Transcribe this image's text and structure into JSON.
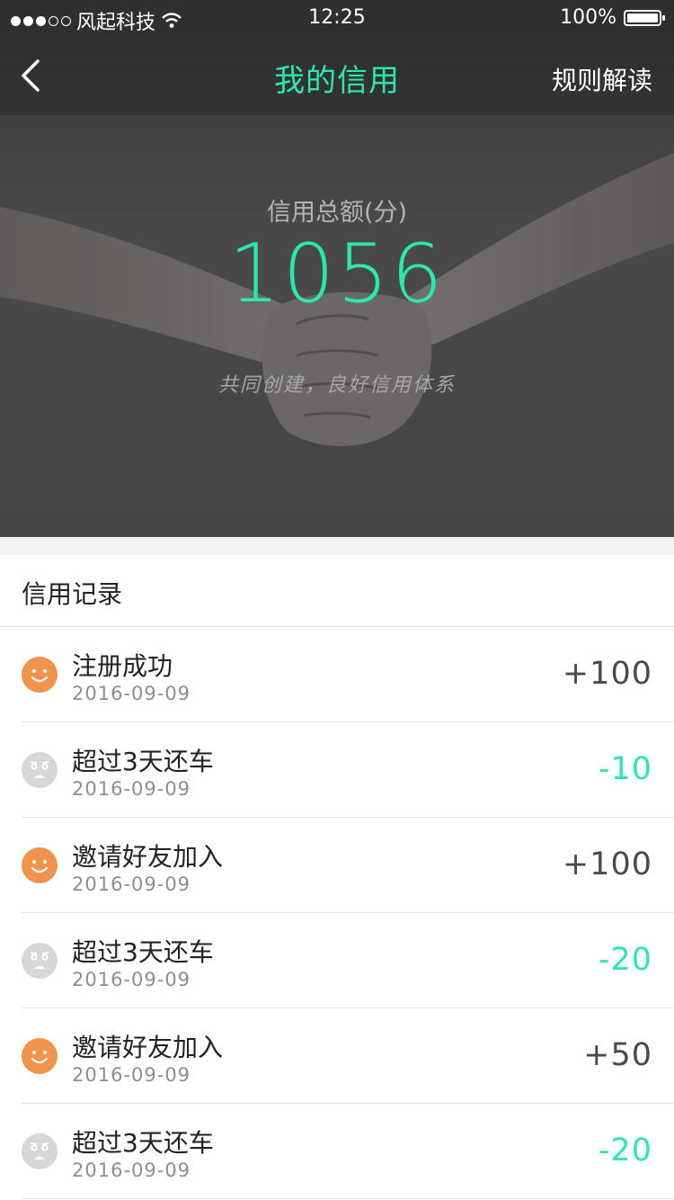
{
  "status_bar": {
    "carrier": "风起科技",
    "time": "12:25",
    "battery": "100%"
  },
  "nav": {
    "title": "我的信用",
    "right_action": "规则解读",
    "title_color": "#2ee6b0"
  },
  "hero": {
    "label": "信用总额(分)",
    "value": "1056",
    "slogan": "共同创建，良好信用体系"
  },
  "records": {
    "title": "信用记录",
    "items": [
      {
        "title": "注册成功",
        "date": "2016-09-09",
        "value": "+100",
        "mood": "happy"
      },
      {
        "title": "超过3天还车",
        "date": "2016-09-09",
        "value": "-10",
        "mood": "sad"
      },
      {
        "title": "邀请好友加入",
        "date": "2016-09-09",
        "value": "+100",
        "mood": "happy"
      },
      {
        "title": "超过3天还车",
        "date": "2016-09-09",
        "value": "-20",
        "mood": "sad"
      },
      {
        "title": "邀请好友加入",
        "date": "2016-09-09",
        "value": "+50",
        "mood": "happy"
      },
      {
        "title": "超过3天还车",
        "date": "2016-09-09",
        "value": "-20",
        "mood": "sad"
      }
    ]
  },
  "colors": {
    "accent": "#2ee6b0",
    "happy": "#f0934c",
    "sad": "#d7d7d7"
  }
}
